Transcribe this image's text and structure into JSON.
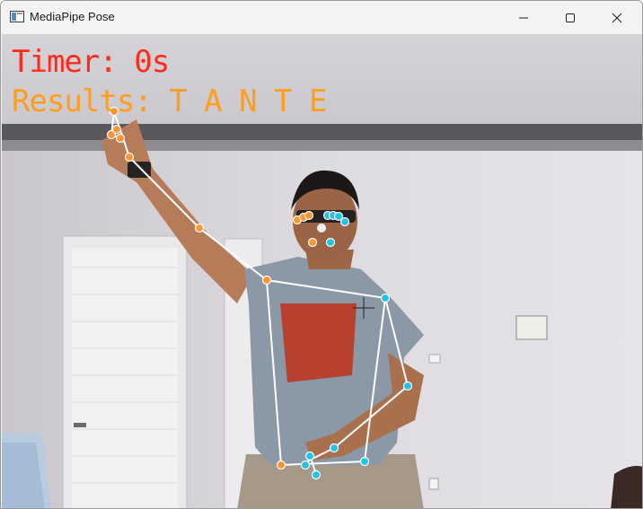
{
  "window": {
    "title": "MediaPipe Pose",
    "app_icon": "window-app-icon",
    "controls": {
      "minimize_icon": "minimize-icon",
      "maximize_icon": "maximize-icon",
      "close_icon": "close-icon"
    }
  },
  "overlay": {
    "timer_text": "Timer: 0s",
    "timer_color": "#ff2a1a",
    "results_text": "Results: T A N T E",
    "results_color": "#ff9d1c"
  },
  "pose": {
    "skeleton_color": "#ffffff",
    "left_side_color": "#ff9430",
    "right_side_color": "#22c3e6"
  }
}
